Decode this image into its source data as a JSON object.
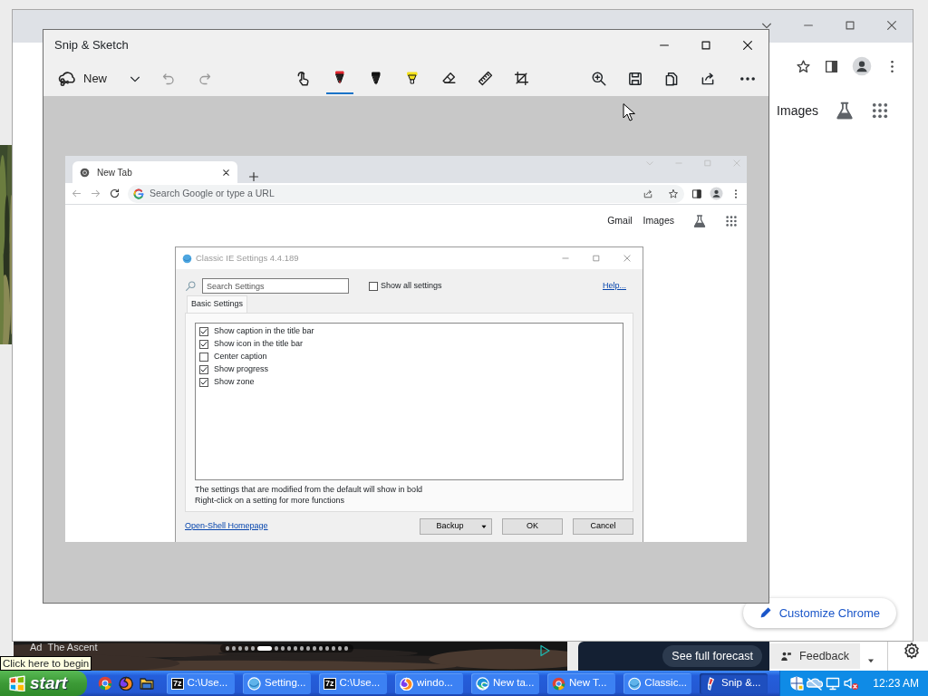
{
  "chrome_window": {
    "links": [
      "Images"
    ],
    "customize_button": "Customize Chrome"
  },
  "news_strip": {
    "ad_label": "Ad",
    "ad_title": "The Ascent",
    "pager_dots": [
      {
        "selected": false
      },
      {
        "selected": false
      },
      {
        "selected": false
      },
      {
        "selected": false
      },
      {
        "selected": false
      },
      {
        "selected": true
      },
      {
        "selected": false
      },
      {
        "selected": false
      },
      {
        "selected": false
      },
      {
        "selected": false
      },
      {
        "selected": false
      },
      {
        "selected": false
      },
      {
        "selected": false
      },
      {
        "selected": false
      },
      {
        "selected": false
      },
      {
        "selected": false
      },
      {
        "selected": false
      },
      {
        "selected": false
      }
    ],
    "forecast_button": "See full forecast",
    "feedback_button": "Feedback"
  },
  "snip_window": {
    "title": "Snip & Sketch",
    "new_button": "New",
    "tools": [
      {
        "kind": "touch",
        "selected": false
      },
      {
        "kind": "pen",
        "color": "#e0262e",
        "selected": true
      },
      {
        "kind": "pen",
        "color": "#111111",
        "selected": false
      },
      {
        "kind": "highlighter",
        "color": "#f4e21c",
        "selected": false
      },
      {
        "kind": "eraser",
        "selected": false
      },
      {
        "kind": "ruler",
        "selected": false
      },
      {
        "kind": "crop",
        "selected": false
      }
    ]
  },
  "screenshot": {
    "tab_title": "New Tab",
    "address_placeholder": "Search Google or type a URL",
    "links": [
      "Gmail",
      "Images"
    ],
    "dialog": {
      "title": "Classic IE Settings 4.4.189",
      "search_placeholder": "Search Settings",
      "show_all": {
        "label": "Show all settings",
        "checked": false
      },
      "help_link": "Help...",
      "tab": "Basic Settings",
      "settings": [
        {
          "label": "Show caption in the title bar",
          "checked": true
        },
        {
          "label": "Show icon in the title bar",
          "checked": true
        },
        {
          "label": "Center caption",
          "checked": false
        },
        {
          "label": "Show progress",
          "checked": true
        },
        {
          "label": "Show zone",
          "checked": true
        }
      ],
      "notes": [
        "The settings that are modified from the default will show in bold",
        "Right-click on a setting for more functions"
      ],
      "homepage_link": "Open-Shell Homepage",
      "buttons": [
        {
          "label": "Backup",
          "kind": "split"
        },
        {
          "label": "OK",
          "kind": "plain"
        },
        {
          "label": "Cancel",
          "kind": "plain"
        }
      ]
    }
  },
  "taskbar": {
    "start": "start",
    "tooltip": "Click here to begin",
    "tasks": [
      {
        "kind": "archive",
        "icon_text": "7z",
        "label": "C:\\Use...",
        "selected": false
      },
      {
        "kind": "settings",
        "label": "Setting...",
        "selected": false
      },
      {
        "kind": "archive",
        "icon_text": "7z",
        "label": "C:\\Use...",
        "selected": false
      },
      {
        "kind": "firefox",
        "label": "windo...",
        "selected": false
      },
      {
        "kind": "edge",
        "label": "New ta...",
        "selected": false
      },
      {
        "kind": "chrome",
        "label": "New T...",
        "selected": false
      },
      {
        "kind": "settings",
        "label": "Classic...",
        "selected": false
      },
      {
        "kind": "snip",
        "label": "Snip &...",
        "selected": true
      }
    ],
    "clock": "12:23 AM"
  }
}
